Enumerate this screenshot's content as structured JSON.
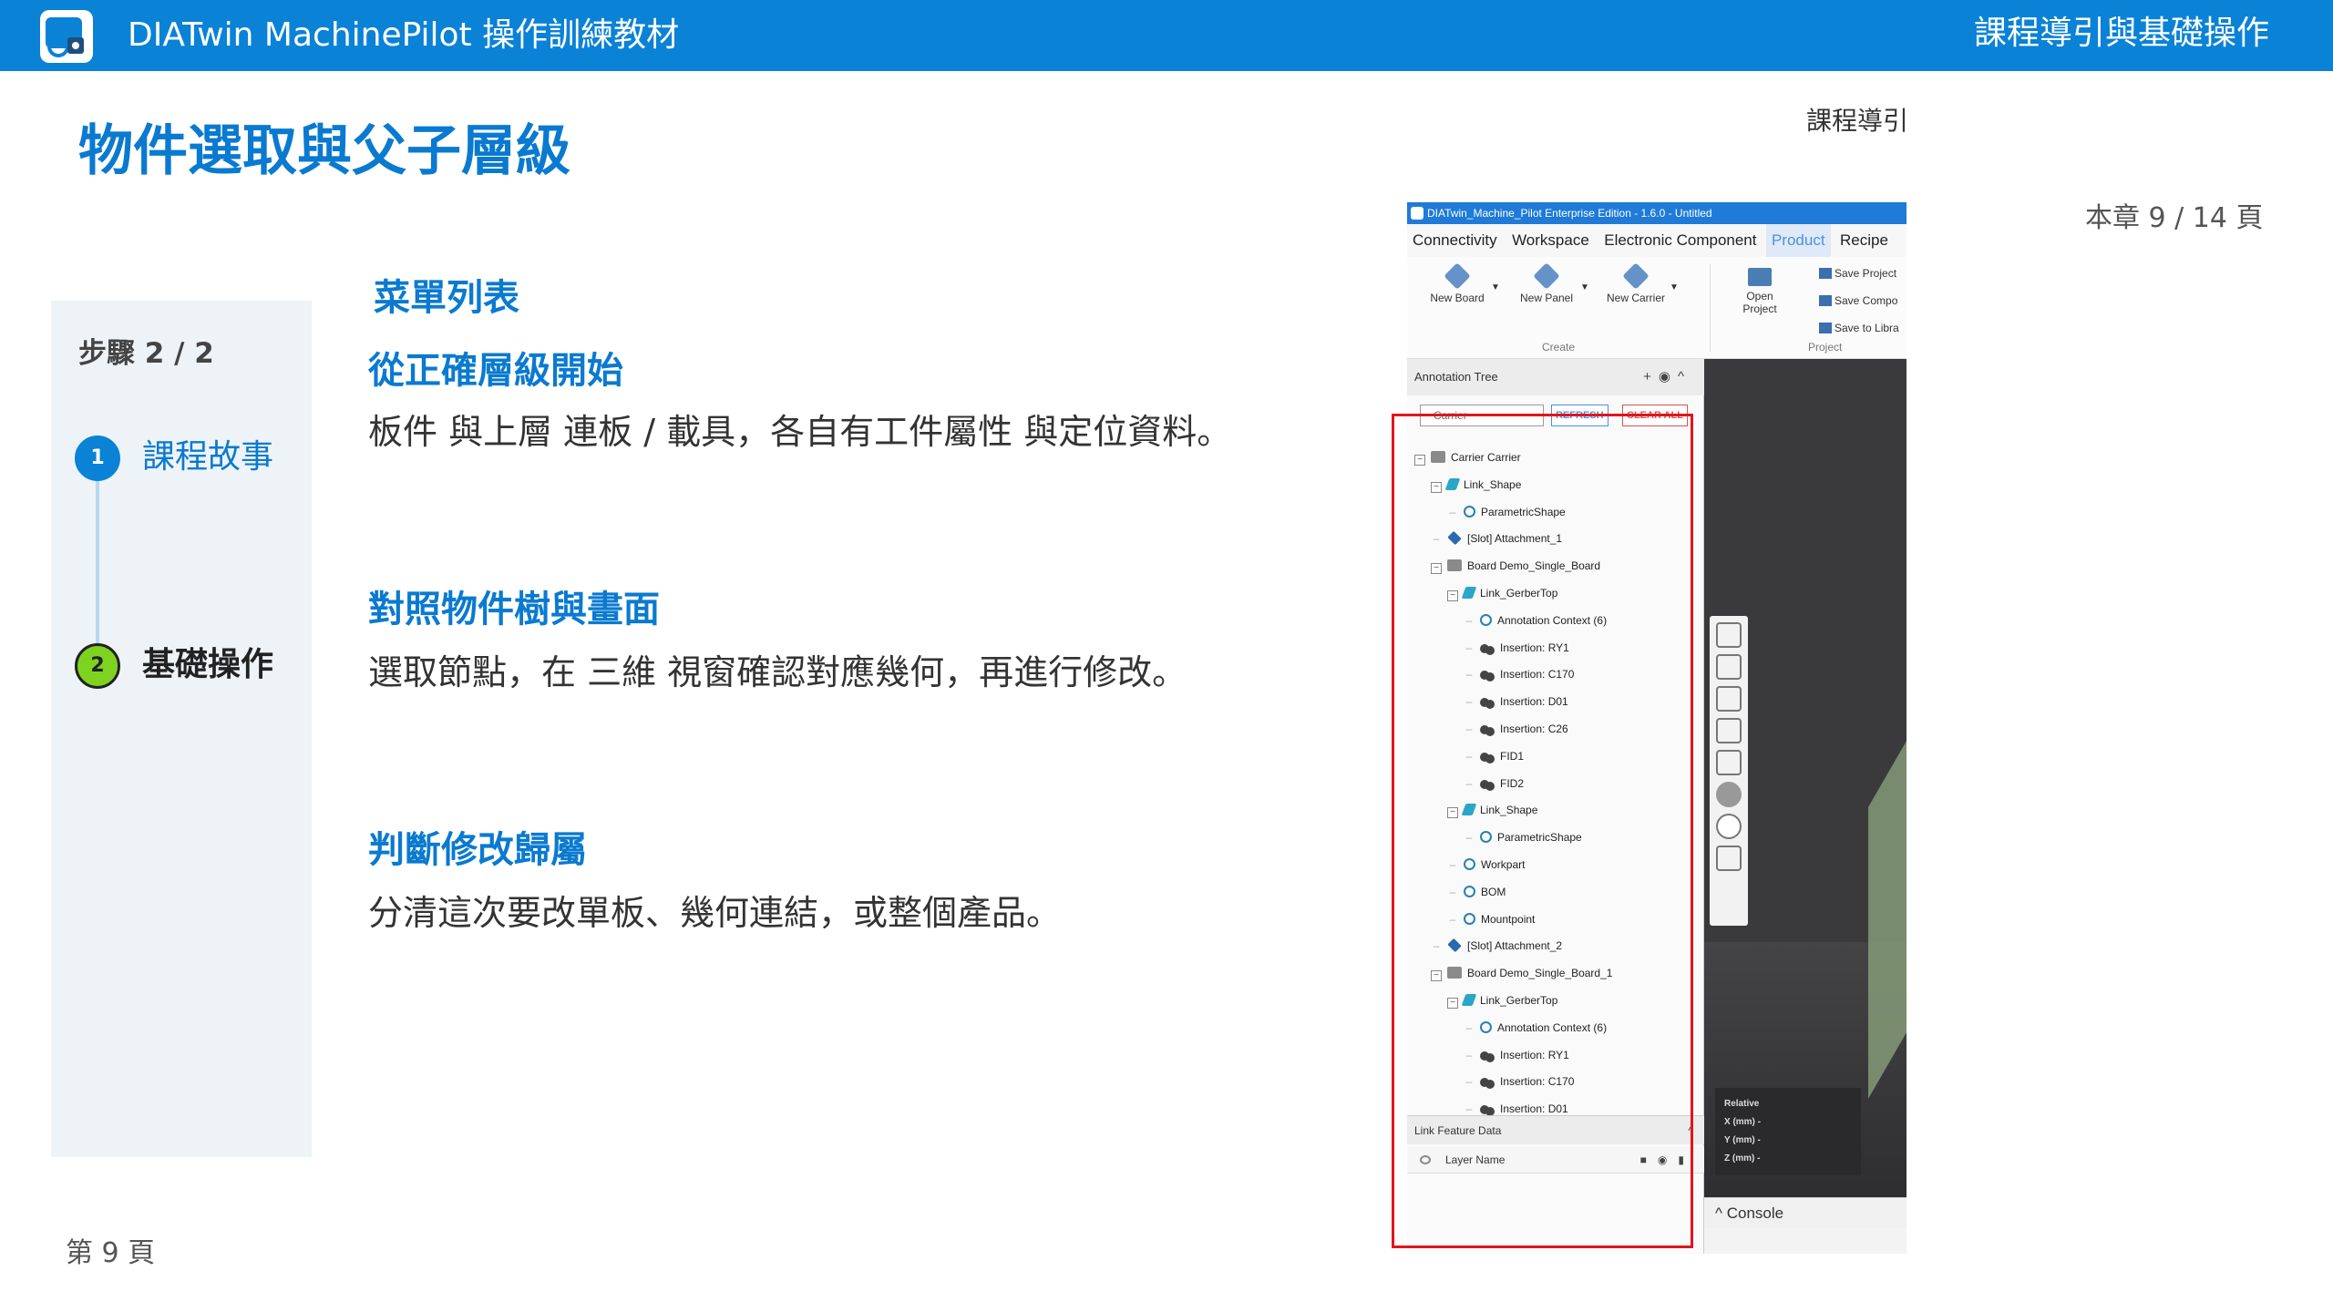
{
  "topbar": {
    "app_title": "DIATwin MachinePilot 操作訓練教材",
    "section_title": "課程導引與基礎操作"
  },
  "header": {
    "page_heading": "物件選取與父子層級",
    "breadcrumb": "課程導引",
    "chapter_page": "本章 9 / 14 頁"
  },
  "steps": {
    "caption": "步驟 2 / 2",
    "items": [
      {
        "num": "1",
        "label": "課程故事"
      },
      {
        "num": "2",
        "label": "基礎操作"
      }
    ]
  },
  "content": {
    "menu_heading": "菜單列表",
    "blocks": [
      {
        "heading": "從正確層級開始",
        "body": "板件 與上層 連板 / 載具，各自有工件屬性 與定位資料。"
      },
      {
        "heading": "對照物件樹與畫面",
        "body": "選取節點，在 三維 視窗確認對應幾何，再進行修改。"
      },
      {
        "heading": "判斷修改歸屬",
        "body": "分清這次要改單板、幾何連結，或整個產品。"
      }
    ]
  },
  "footer": {
    "page_number": "第 9 頁"
  },
  "screenshot": {
    "window_title": "DIATwin_Machine_Pilot Enterprise Edition - 1.6.0 - Untitled",
    "menu": [
      "Connectivity",
      "Workspace",
      "Electronic Component",
      "Product",
      "Recipe"
    ],
    "active_menu": "Product",
    "ribbon": {
      "buttons": [
        {
          "label": "New Board",
          "icon": "board-cube-icon"
        },
        {
          "label": "New Panel",
          "icon": "panel-cube-icon"
        },
        {
          "label": "New Carrier",
          "icon": "carrier-cube-icon"
        },
        {
          "label": "Open Project",
          "icon": "folder-icon"
        }
      ],
      "small_buttons": [
        "Save Project",
        "Save Compo",
        "Save to Libra"
      ],
      "group_create": "Create",
      "group_project": "Project"
    },
    "annotation_tree": {
      "title": "Annotation Tree",
      "dropdown_value": "Carrier",
      "refresh": "REFRESH",
      "clear_all": "CLEAR ALL",
      "rows": [
        {
          "indent": 0,
          "toggle": "expand",
          "icon": "folder",
          "text": "Carrier Carrier"
        },
        {
          "indent": 1,
          "toggle": "expand",
          "icon": "link",
          "text": "Link_Shape"
        },
        {
          "indent": 2,
          "toggle": "leaf",
          "icon": "param",
          "text": "ParametricShape"
        },
        {
          "indent": 1,
          "toggle": "leaf",
          "icon": "slot",
          "text": "[Slot] Attachment_1"
        },
        {
          "indent": 1,
          "toggle": "expand",
          "icon": "folder",
          "text": "Board Demo_Single_Board"
        },
        {
          "indent": 2,
          "toggle": "expand",
          "icon": "link",
          "text": "Link_GerberTop"
        },
        {
          "indent": 3,
          "toggle": "leaf",
          "icon": "param",
          "text": "Annotation Context (6)"
        },
        {
          "indent": 3,
          "toggle": "leaf",
          "icon": "ins",
          "text": "Insertion: RY1"
        },
        {
          "indent": 3,
          "toggle": "leaf",
          "icon": "ins",
          "text": "Insertion: C170"
        },
        {
          "indent": 3,
          "toggle": "leaf",
          "icon": "ins",
          "text": "Insertion: D01"
        },
        {
          "indent": 3,
          "toggle": "leaf",
          "icon": "ins",
          "text": "Insertion: C26"
        },
        {
          "indent": 3,
          "toggle": "leaf",
          "icon": "ins",
          "text": "FID1"
        },
        {
          "indent": 3,
          "toggle": "leaf",
          "icon": "ins",
          "text": "FID2"
        },
        {
          "indent": 2,
          "toggle": "expand",
          "icon": "link",
          "text": "Link_Shape"
        },
        {
          "indent": 3,
          "toggle": "leaf",
          "icon": "param",
          "text": "ParametricShape"
        },
        {
          "indent": 2,
          "toggle": "leaf",
          "icon": "param",
          "text": "Workpart"
        },
        {
          "indent": 2,
          "toggle": "leaf",
          "icon": "param",
          "text": "BOM"
        },
        {
          "indent": 2,
          "toggle": "leaf",
          "icon": "param",
          "text": "Mountpoint"
        },
        {
          "indent": 1,
          "toggle": "leaf",
          "icon": "slot",
          "text": "[Slot] Attachment_2"
        },
        {
          "indent": 1,
          "toggle": "expand",
          "icon": "folder",
          "text": "Board Demo_Single_Board_1"
        },
        {
          "indent": 2,
          "toggle": "expand",
          "icon": "link",
          "text": "Link_GerberTop"
        },
        {
          "indent": 3,
          "toggle": "leaf",
          "icon": "param",
          "text": "Annotation Context (6)"
        },
        {
          "indent": 3,
          "toggle": "leaf",
          "icon": "ins",
          "text": "Insertion: RY1"
        },
        {
          "indent": 3,
          "toggle": "leaf",
          "icon": "ins",
          "text": "Insertion: C170"
        },
        {
          "indent": 3,
          "toggle": "leaf",
          "icon": "ins",
          "text": "Insertion: D01"
        }
      ]
    },
    "link_feature_data": {
      "title": "Link Feature Data",
      "layer_name": "Layer Name"
    },
    "coords": {
      "title": "Relative",
      "x": "X (mm)",
      "y": "Y (mm)",
      "z": "Z (mm)",
      "x_value": "-",
      "y_value": "-",
      "z_value": "-"
    },
    "console": "Console"
  },
  "colors": {
    "primary_blue": "#0a82d6",
    "heading_blue": "#0a7ad0",
    "step_green": "#7ed321",
    "highlight_red": "#e0161d"
  }
}
